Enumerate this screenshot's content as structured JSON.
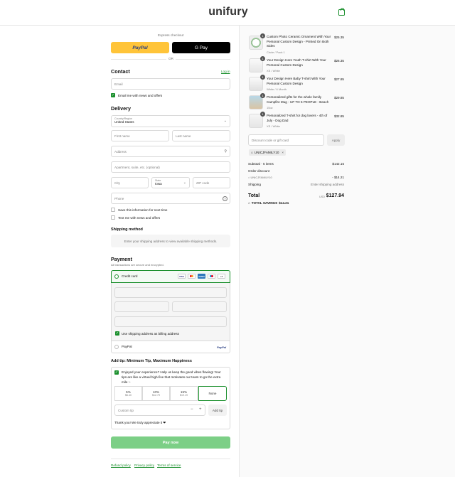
{
  "brand": {
    "logo_text": "unifury",
    "accent": "#1a8f2c"
  },
  "express": {
    "label": "Express checkout",
    "paypal": "PayPal",
    "gpay": "G Pay",
    "or": "OR"
  },
  "contact": {
    "title": "Contact",
    "login": "Log in",
    "email_placeholder": "Email",
    "news_label": "Email me with news and offers",
    "news_checked": true
  },
  "delivery": {
    "title": "Delivery",
    "country_label": "Country/Region",
    "country_value": "United States",
    "first_name": "First name",
    "last_name": "Last name",
    "address": "Address",
    "apartment": "Apartment, suite, etc. (optional)",
    "city": "City",
    "state_label": "State",
    "state_value": "Iowa",
    "zip": "ZIP code",
    "phone": "Phone",
    "save_info": "Save this information for next time",
    "text_me": "Text me with news and offers"
  },
  "shipping_method": {
    "title": "Shipping method",
    "message": "Enter your shipping address to view available shipping methods."
  },
  "payment": {
    "title": "Payment",
    "subtitle": "All transactions are secure and encrypted.",
    "credit_card": "Credit card",
    "cards": [
      "VISA",
      "MC",
      "AMEX",
      "MAE",
      "+4"
    ],
    "billing_same": "Use shipping address as billing address",
    "paypal": "PayPal",
    "paypal_logo": "PayPal"
  },
  "tip": {
    "title": "Add tip: Minimum Tip, Maximum Happiness",
    "message": "Enjoyed your experience? Help us keep the good vibes flowing! Your tips are like a virtual high-five that motivates our team to go the extra mile :-",
    "options": [
      {
        "pct": "5%",
        "amount": "$6.40"
      },
      {
        "pct": "10%",
        "amount": "$12.79"
      },
      {
        "pct": "15%",
        "amount": "$19.19"
      }
    ],
    "none": "None",
    "custom_placeholder": "Custom tip",
    "minus": "−",
    "plus": "+",
    "add_button": "Add tip",
    "thanks": "Thank you! We truly appreciate it ❤"
  },
  "pay_now": "Pay now",
  "footer": {
    "refund": "Refund policy",
    "privacy": "Privacy policy",
    "terms": "Terms of service"
  },
  "summary": {
    "items": [
      {
        "qty": "1",
        "title": "Custom Photo Ceramic Ornament With Your Personal Custom Design - Printed On Both Sides",
        "variant": "Circle / Pack 1",
        "price": "$25.35"
      },
      {
        "qty": "1",
        "title": "Your Design Here Youth T-shirt With Your Personal Custom Design",
        "variant": "XS / White",
        "price": "$26.35"
      },
      {
        "qty": "1",
        "title": "Your Design Here Baby T-shirt With Your Personal Custom Design",
        "variant": "White / 6 Month",
        "price": "$27.85"
      },
      {
        "qty": "1",
        "title": "Personalized gifts for the whole family Campfire Mug - UP TO 5 PEOPLE - Beach",
        "variant": "15oz",
        "price": "$29.85"
      },
      {
        "qty": "1",
        "title": "Personalized T-shirt for dog lovers - 4th of July - Dog Dad",
        "variant": "XS / White",
        "price": "$32.85"
      }
    ],
    "discount_placeholder": "Discount code or gift card",
    "apply": "Apply",
    "applied_code": "UNICJFAMILY10",
    "subtotal_label": "Subtotal · 5 items",
    "subtotal_value": "$142.15",
    "order_discount_label": "Order discount",
    "discount_code": "UNICJFAMILY10",
    "discount_value": "- $14.21",
    "shipping_label": "Shipping",
    "shipping_value": "Enter shipping address",
    "total_label": "Total",
    "currency": "USD",
    "total_value": "$127.94",
    "savings_label": "TOTAL SAVINGS",
    "savings_value": "$14.21"
  }
}
